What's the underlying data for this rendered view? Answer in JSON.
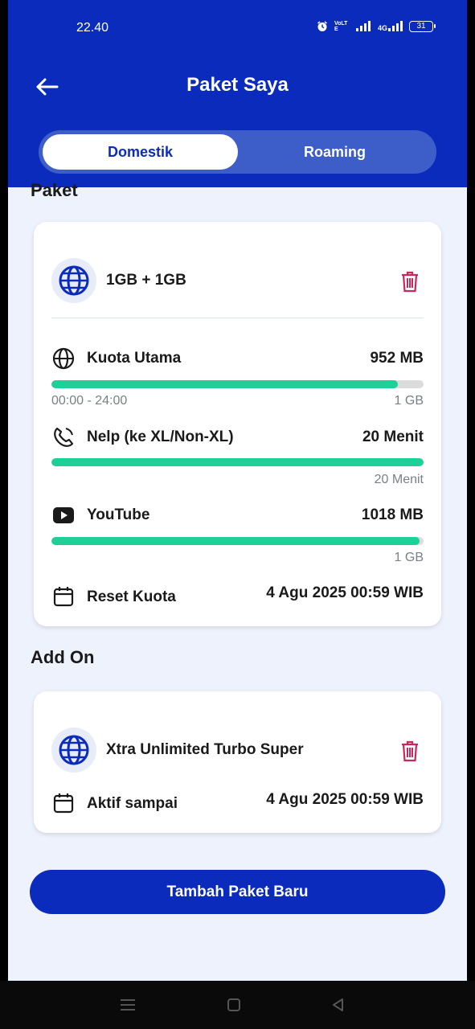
{
  "status_bar": {
    "time": "22.40",
    "icons": [
      "alarm-icon",
      "volte-icon",
      "signal-icon",
      "4g-signal-icon",
      "battery-icon"
    ],
    "volte": "VoLTE",
    "network": "4G",
    "battery": "31"
  },
  "header": {
    "title": "Paket Saya",
    "back_icon": "arrow-left-icon"
  },
  "tabs": [
    {
      "label": "Domestik",
      "active": true
    },
    {
      "label": "Roaming",
      "active": false
    }
  ],
  "paket_section": {
    "title": "Paket",
    "card": {
      "name": "1GB + 1GB",
      "icon": "globe-icon",
      "items": [
        {
          "icon": "globe-icon",
          "label": "Kuota Utama",
          "value": "952 MB",
          "progress": 0.93,
          "sub_left": "00:00 - 24:00",
          "sub_right": "1 GB"
        },
        {
          "icon": "phone-call-icon",
          "label": "Nelp (ke XL/Non-XL)",
          "value": "20 Menit",
          "progress": 1.0,
          "sub_left": "",
          "sub_right": "20 Menit"
        },
        {
          "icon": "youtube-icon",
          "label": "YouTube",
          "value": "1018 MB",
          "progress": 0.99,
          "sub_left": "",
          "sub_right": "1 GB"
        }
      ],
      "reset": {
        "icon": "calendar-icon",
        "label": "Reset Kuota",
        "value": "4 Agu 2025 00:59 WIB"
      }
    }
  },
  "addon_section": {
    "title": "Add On",
    "card": {
      "name": "Xtra Unlimited Turbo Super",
      "icon": "globe-icon",
      "active_until": {
        "icon": "calendar-icon",
        "label": "Aktif sampai",
        "value": "4 Agu 2025 00:59 WIB"
      }
    }
  },
  "primary_button": "Tambah Paket Baru",
  "colors": {
    "brand": "#0b2bbd",
    "progress": "#1ecf97",
    "trash": "#c8285a",
    "background": "#eef2fc"
  }
}
